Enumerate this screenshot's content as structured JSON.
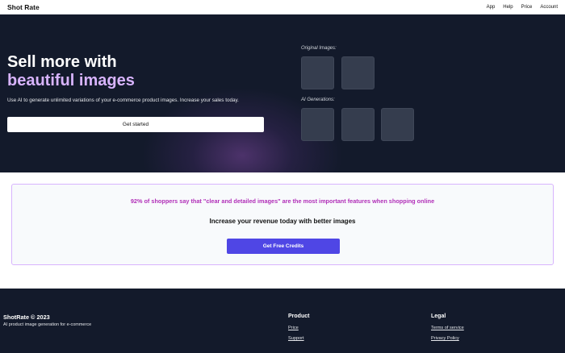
{
  "nav": {
    "brand": "Shot Rate",
    "links": [
      "App",
      "Help",
      "Price",
      "Account"
    ]
  },
  "hero": {
    "title_line1": "Sell more with",
    "title_line2": "beautiful images",
    "description": "Use AI to generate unlimited variations of your e-commerce product images. Increase your sales today.",
    "cta_label": "Get started",
    "original_label": "Original Images:",
    "generations_label": "AI Generations:"
  },
  "banner": {
    "stat": "92% of shoppers say that \"clear and detailed images\" are the most important features when shopping online",
    "subhead": "Increase your revenue today with better images",
    "button_label": "Get Free Credits"
  },
  "footer": {
    "brand": "ShotRate © 2023",
    "tagline": "AI product image generation for e-commerce",
    "product": {
      "title": "Product",
      "links": [
        "Price",
        "Support"
      ]
    },
    "legal": {
      "title": "Legal",
      "links": [
        "Terms of service",
        "Privacy Policy"
      ]
    }
  },
  "colors": {
    "hero_bg": "#131a2b",
    "accent_purple": "#d8b4fe",
    "stat_magenta": "#b12fb8",
    "button_indigo": "#4f46e5"
  }
}
